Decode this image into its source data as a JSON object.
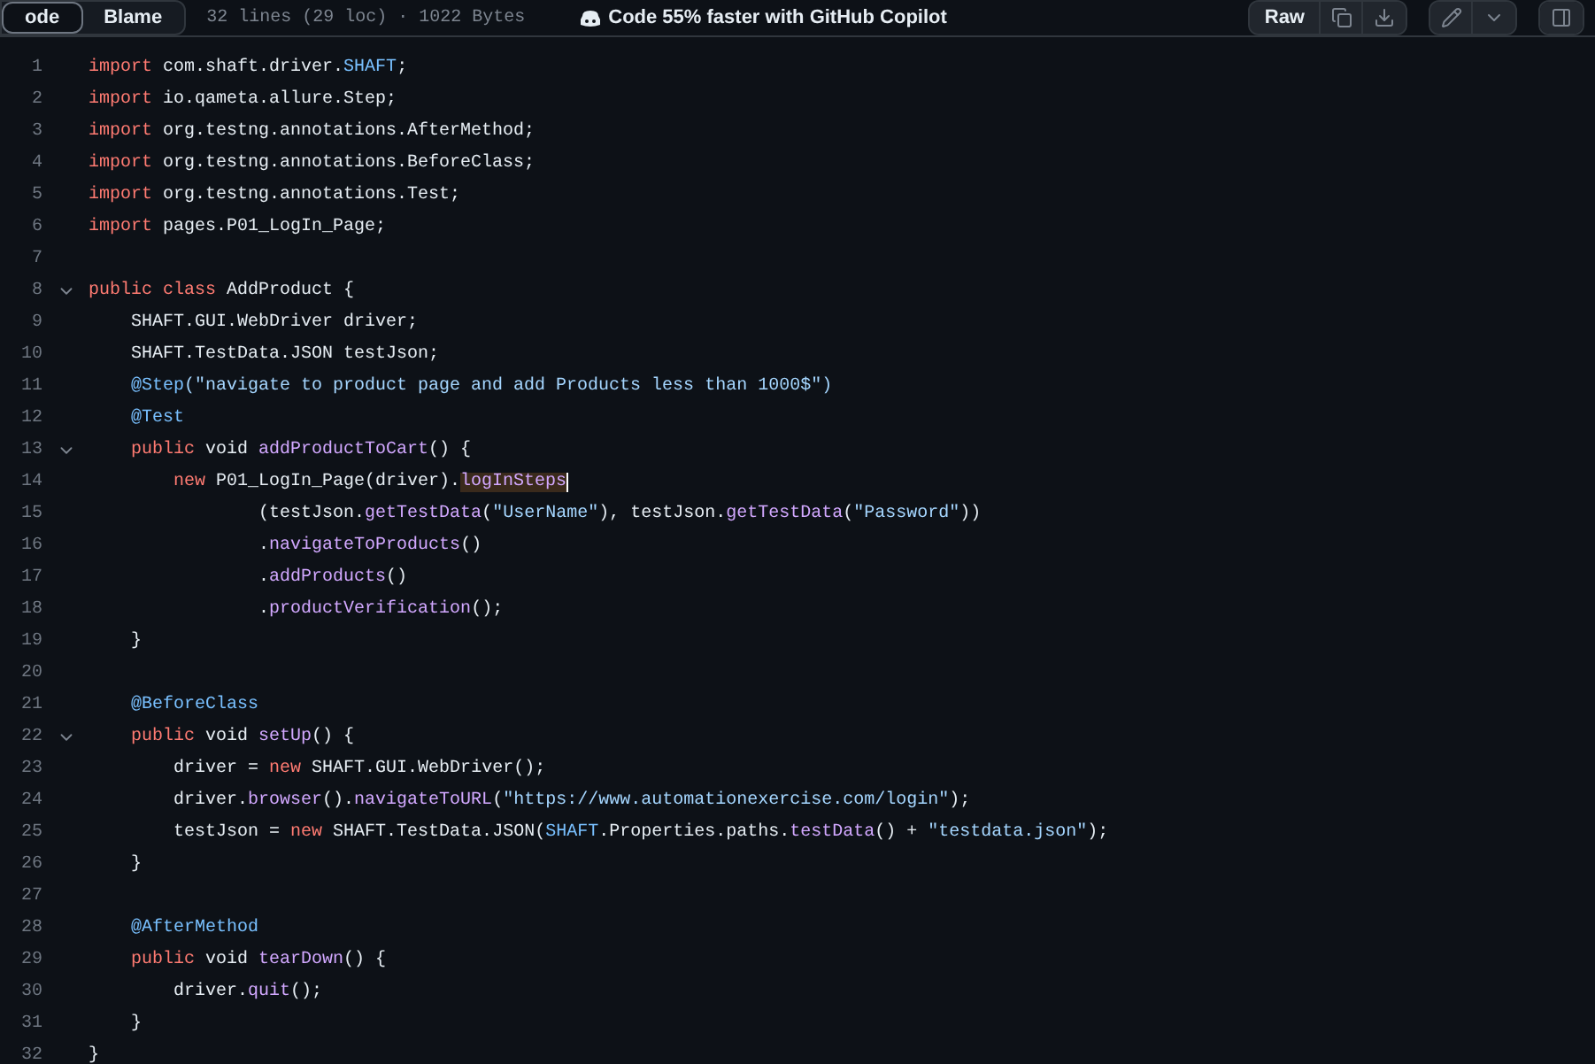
{
  "toolbar": {
    "tabs": [
      {
        "label": "ode",
        "selected": true
      },
      {
        "label": "Blame",
        "selected": false
      }
    ],
    "file_info": "32 lines (29 loc) · 1022 Bytes",
    "copilot_notice": "Code 55% faster with GitHub Copilot",
    "raw_button": "Raw"
  },
  "code": {
    "lines": [
      {
        "number": "1",
        "tokens": [
          {
            "kind": "keyword",
            "text": "import"
          },
          {
            "kind": "plain",
            "text": " com.shaft.driver."
          },
          {
            "kind": "constant",
            "text": "SHAFT"
          },
          {
            "kind": "plain",
            "text": ";"
          }
        ]
      },
      {
        "number": "2",
        "tokens": [
          {
            "kind": "keyword",
            "text": "import"
          },
          {
            "kind": "plain",
            "text": " io.qameta.allure.Step;"
          }
        ]
      },
      {
        "number": "3",
        "tokens": [
          {
            "kind": "keyword",
            "text": "import"
          },
          {
            "kind": "plain",
            "text": " org.testng.annotations.AfterMethod;"
          }
        ]
      },
      {
        "number": "4",
        "tokens": [
          {
            "kind": "keyword",
            "text": "import"
          },
          {
            "kind": "plain",
            "text": " org.testng.annotations.BeforeClass;"
          }
        ]
      },
      {
        "number": "5",
        "tokens": [
          {
            "kind": "keyword",
            "text": "import"
          },
          {
            "kind": "plain",
            "text": " org.testng.annotations.Test;"
          }
        ]
      },
      {
        "number": "6",
        "tokens": [
          {
            "kind": "keyword",
            "text": "import"
          },
          {
            "kind": "plain",
            "text": " pages.P01_LogIn_Page;"
          }
        ]
      },
      {
        "number": "7"
      },
      {
        "number": "8",
        "foldable": true,
        "tokens": [
          {
            "kind": "keyword",
            "text": "public class"
          },
          {
            "kind": "plain",
            "text": " AddProduct {"
          }
        ]
      },
      {
        "number": "9",
        "tokens": [
          {
            "kind": "plain",
            "text": "    SHAFT.GUI.WebDriver driver;"
          }
        ]
      },
      {
        "number": "10",
        "tokens": [
          {
            "kind": "plain",
            "text": "    SHAFT.TestData.JSON testJson;"
          }
        ]
      },
      {
        "number": "11",
        "tokens": [
          {
            "kind": "constant",
            "text": "    @Step"
          },
          {
            "kind": "string",
            "text": "(\"navigate to product page and add Products less than 1000$\")"
          }
        ]
      },
      {
        "number": "12",
        "tokens": [
          {
            "kind": "constant",
            "text": "    @Test"
          }
        ]
      },
      {
        "number": "13",
        "foldable": true,
        "tokens": [
          {
            "kind": "keyword",
            "text": "    public"
          },
          {
            "kind": "plain",
            "text": " void "
          },
          {
            "kind": "function",
            "text": "addProductToCart"
          },
          {
            "kind": "plain",
            "text": "() {"
          }
        ]
      },
      {
        "number": "14",
        "tokens": [
          {
            "kind": "keyword",
            "text": "        new"
          },
          {
            "kind": "plain",
            "text": " P01_LogIn_Page(driver)."
          },
          {
            "kind": "function",
            "text": "logInSteps",
            "highlighted": true
          }
        ]
      },
      {
        "number": "15",
        "tokens": [
          {
            "kind": "plain",
            "text": "                (testJson."
          },
          {
            "kind": "function",
            "text": "getTestData"
          },
          {
            "kind": "plain",
            "text": "("
          },
          {
            "kind": "string",
            "text": "\"UserName\""
          },
          {
            "kind": "plain",
            "text": "), testJson."
          },
          {
            "kind": "function",
            "text": "getTestData"
          },
          {
            "kind": "plain",
            "text": "("
          },
          {
            "kind": "string",
            "text": "\"Password\""
          },
          {
            "kind": "plain",
            "text": "))"
          }
        ]
      },
      {
        "number": "16",
        "tokens": [
          {
            "kind": "plain",
            "text": "                ."
          },
          {
            "kind": "function",
            "text": "navigateToProducts"
          },
          {
            "kind": "plain",
            "text": "()"
          }
        ]
      },
      {
        "number": "17",
        "tokens": [
          {
            "kind": "plain",
            "text": "                ."
          },
          {
            "kind": "function",
            "text": "addProducts"
          },
          {
            "kind": "plain",
            "text": "()"
          }
        ]
      },
      {
        "number": "18",
        "tokens": [
          {
            "kind": "plain",
            "text": "                ."
          },
          {
            "kind": "function",
            "text": "productVerification"
          },
          {
            "kind": "plain",
            "text": "();"
          }
        ]
      },
      {
        "number": "19",
        "tokens": [
          {
            "kind": "plain",
            "text": "    }"
          }
        ]
      },
      {
        "number": "20"
      },
      {
        "number": "21",
        "tokens": [
          {
            "kind": "constant",
            "text": "    @BeforeClass"
          }
        ]
      },
      {
        "number": "22",
        "foldable": true,
        "tokens": [
          {
            "kind": "keyword",
            "text": "    public"
          },
          {
            "kind": "plain",
            "text": " void "
          },
          {
            "kind": "function",
            "text": "setUp"
          },
          {
            "kind": "plain",
            "text": "() {"
          }
        ]
      },
      {
        "number": "23",
        "tokens": [
          {
            "kind": "plain",
            "text": "        driver = "
          },
          {
            "kind": "keyword",
            "text": "new"
          },
          {
            "kind": "plain",
            "text": " SHAFT.GUI.WebDriver();"
          }
        ]
      },
      {
        "number": "24",
        "tokens": [
          {
            "kind": "plain",
            "text": "        driver."
          },
          {
            "kind": "function",
            "text": "browser"
          },
          {
            "kind": "plain",
            "text": "()."
          },
          {
            "kind": "function",
            "text": "navigateToURL"
          },
          {
            "kind": "plain",
            "text": "("
          },
          {
            "kind": "string",
            "text": "\"https://www.automationexercise.com/login\""
          },
          {
            "kind": "plain",
            "text": ");"
          }
        ]
      },
      {
        "number": "25",
        "tokens": [
          {
            "kind": "plain",
            "text": "        testJson = "
          },
          {
            "kind": "keyword",
            "text": "new"
          },
          {
            "kind": "plain",
            "text": " SHAFT.TestData.JSON("
          },
          {
            "kind": "constant",
            "text": "SHAFT"
          },
          {
            "kind": "plain",
            "text": ".Properties.paths."
          },
          {
            "kind": "function",
            "text": "testData"
          },
          {
            "kind": "plain",
            "text": "() + "
          },
          {
            "kind": "string",
            "text": "\"testdata.json\""
          },
          {
            "kind": "plain",
            "text": ");"
          }
        ]
      },
      {
        "number": "26",
        "tokens": [
          {
            "kind": "plain",
            "text": "    }"
          }
        ]
      },
      {
        "number": "27"
      },
      {
        "number": "28",
        "tokens": [
          {
            "kind": "constant",
            "text": "    @AfterMethod"
          }
        ]
      },
      {
        "number": "29",
        "tokens": [
          {
            "kind": "keyword",
            "text": "    public"
          },
          {
            "kind": "plain",
            "text": " void "
          },
          {
            "kind": "function",
            "text": "tearDown"
          },
          {
            "kind": "plain",
            "text": "() {"
          }
        ]
      },
      {
        "number": "30",
        "tokens": [
          {
            "kind": "plain",
            "text": "        driver."
          },
          {
            "kind": "function",
            "text": "quit"
          },
          {
            "kind": "plain",
            "text": "();"
          }
        ]
      },
      {
        "number": "31",
        "tokens": [
          {
            "kind": "plain",
            "text": "    }"
          }
        ]
      },
      {
        "number": "32",
        "tokens": [
          {
            "kind": "plain",
            "text": "}"
          }
        ]
      }
    ]
  }
}
